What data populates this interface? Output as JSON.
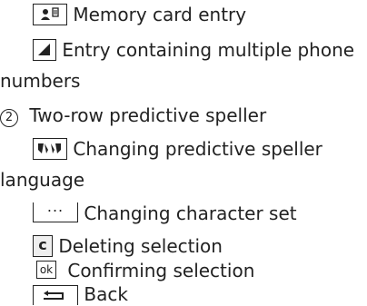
{
  "items": [
    {
      "text": "Memory card entry",
      "icon": "memory-card-icon"
    },
    {
      "text_line1": "Entry containing multiple phone",
      "text_line2": "numbers",
      "icon": "multiple-numbers-icon"
    },
    {
      "marker": "2",
      "text": "Two-row predictive speller"
    },
    {
      "text_line1": "Changing predictive speller",
      "text_line2": "language",
      "icon": "speller-language-icon"
    },
    {
      "text": "Changing character set",
      "icon": "character-set-icon",
      "icon_label": "..."
    },
    {
      "text": "Deleting selection",
      "icon": "delete-icon",
      "icon_label": "c"
    },
    {
      "text": "Confirming selection",
      "icon": "confirm-icon",
      "icon_label": "ok"
    },
    {
      "text": "Back",
      "icon": "back-icon"
    }
  ]
}
